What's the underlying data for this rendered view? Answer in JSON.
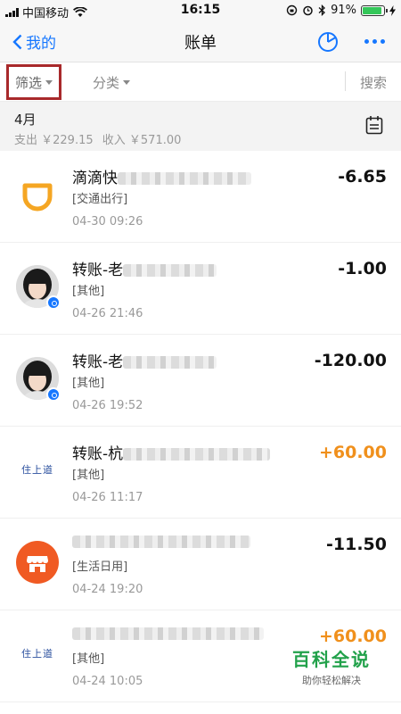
{
  "status_bar": {
    "carrier": "中国移动",
    "time": "16:15",
    "battery": "91%",
    "battery_level": 0.91
  },
  "nav": {
    "back_label": "我的",
    "title": "账单"
  },
  "filters": {
    "filter_label": "筛选",
    "category_label": "分类",
    "search_label": "搜索"
  },
  "month": {
    "title": "4月",
    "expense": "支出 ￥229.15",
    "income": "收入 ￥571.00"
  },
  "bills": [
    {
      "title": "滴滴快",
      "category": "[交通出行]",
      "time": "04-30  09:26",
      "amount": "-6.65",
      "type": "expense",
      "icon": "didi-logo-icon"
    },
    {
      "title": "转账-老",
      "category": "[其他]",
      "time": "04-26  21:46",
      "amount": "-1.00",
      "type": "expense",
      "icon": "user-avatar"
    },
    {
      "title": "转账-老",
      "category": "[其他]",
      "time": "04-26  19:52",
      "amount": "-120.00",
      "type": "expense",
      "icon": "user-avatar"
    },
    {
      "title": "转账-杭",
      "category": "[其他]",
      "time": "04-26  11:17",
      "amount": "+60.00",
      "type": "income",
      "icon": "zhushang-logo-icon"
    },
    {
      "title": "",
      "category": "[生活日用]",
      "time": "04-24  19:20",
      "amount": "-11.50",
      "type": "expense",
      "icon": "shop-icon"
    },
    {
      "title": "",
      "category": "[其他]",
      "time": "04-24  10:05",
      "amount": "+60.00",
      "type": "income",
      "icon": "zhushang-logo-icon"
    }
  ],
  "logo_text": "住上道",
  "watermark": {
    "title": "百科全说",
    "subtitle": "助你轻松解决"
  },
  "colors": {
    "accent": "#1677ff",
    "income": "#f0901c",
    "highlight_box": "#a8292b",
    "watermark": "#21a14a"
  }
}
